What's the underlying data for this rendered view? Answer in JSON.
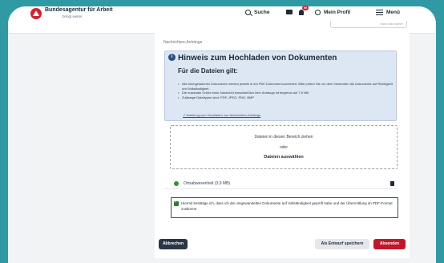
{
  "header": {
    "brand_title": "Bundesagentur für Arbeit",
    "brand_subtitle": "bringt weiter",
    "search_label": "Suche",
    "notification_count": "99",
    "profile_label": "Mein Profil",
    "menu_label": "Menü"
  },
  "form": {
    "previous_button": "nach was weiter",
    "attachments_label": "Nachrichten-Anhänge",
    "info": {
      "title": "Hinweis zum Hochladen von Dokumenten",
      "subtitle": "Für die Dateien gilt:",
      "items": [
        "Alle hochgeladenen Dokumente werden jeweils in ein PDF-Dokument konvertiert. Bitte prüfen Sie vor dem Versenden die Dokumente auf Richtigkeit und Vollständigkeit.",
        "Die maximale Größe einer Nachricht einschließlich ihrer Anhänge ist begrenzt auf 7,5 MB",
        "Zulässige Dateitypen sind: PDF, JPEG, PNG, BMP"
      ],
      "link": "Anleitung zum Hochladen von Nachrichten-Anhänge"
    },
    "dropzone": {
      "line1": "Dateien in diesen Bereich ziehen",
      "or": "oder",
      "button": "Dateien auswählen"
    },
    "file": {
      "name": "Ortsabwesenheit (3,9 MB)"
    },
    "confirm_text": "Hiermit bestätige ich, dass ich die umgewandelten Dokumente auf Vollständigkeit geprüft habe und der Übermittlung im PDF-Format zustimme",
    "buttons": {
      "cancel": "Abbrechen",
      "draft": "Als Entwurf speichern",
      "send": "Absenden"
    }
  },
  "colors": {
    "frame": "#2f9aa3",
    "brand_red": "#d6202f",
    "info_bg": "#dde6f3",
    "send_button": "#c0182a",
    "cancel_button": "#2b3645"
  }
}
